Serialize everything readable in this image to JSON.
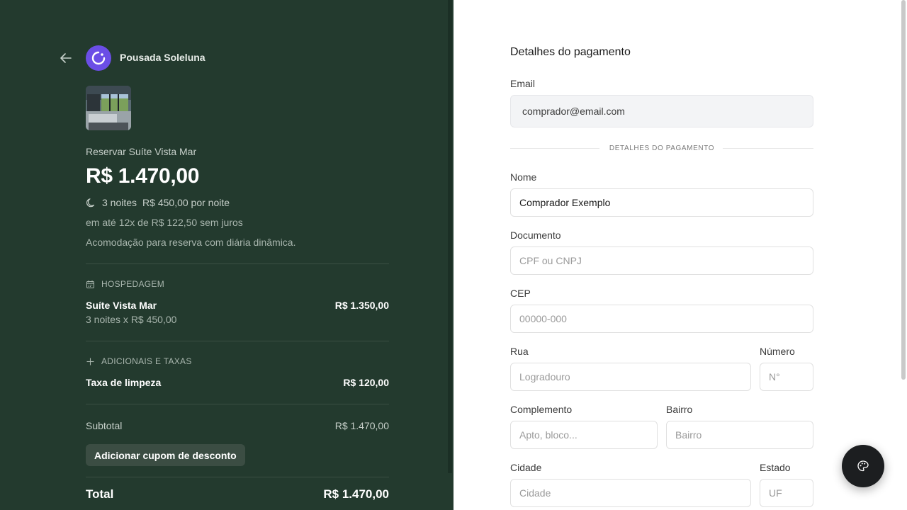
{
  "merchant": {
    "name": "Pousada Soleluna"
  },
  "product": {
    "title": "Reservar Suíte Vista Mar",
    "price": "R$ 1.470,00",
    "nights": "3 noites",
    "per_night": "R$ 450,00 por noite",
    "installments": "em até 12x de R$ 122,50 sem juros",
    "description": "Acomodação para reserva com diária dinâmica."
  },
  "summary": {
    "lodging_section": "HOSPEDAGEM",
    "lodging_item": {
      "name": "Suíte Vista Mar",
      "detail": "3 noites x R$ 450,00",
      "amount": "R$ 1.350,00"
    },
    "extras_section": "ADICIONAIS E TAXAS",
    "extras_item": {
      "name": "Taxa de limpeza",
      "amount": "R$ 120,00"
    },
    "subtotal_label": "Subtotal",
    "subtotal_amount": "R$ 1.470,00",
    "coupon_label": "Adicionar cupom de desconto",
    "total_label": "Total",
    "total_amount": "R$ 1.470,00"
  },
  "form": {
    "title": "Detalhes do pagamento",
    "email": {
      "label": "Email",
      "value": "comprador@email.com"
    },
    "separator": "DETALHES DO PAGAMENTO",
    "name": {
      "label": "Nome",
      "value": "Comprador Exemplo"
    },
    "document": {
      "label": "Documento",
      "placeholder": "CPF ou CNPJ"
    },
    "cep": {
      "label": "CEP",
      "placeholder": "00000-000"
    },
    "street": {
      "label": "Rua",
      "placeholder": "Logradouro"
    },
    "number": {
      "label": "Número",
      "placeholder": "N°"
    },
    "complement": {
      "label": "Complemento",
      "placeholder": "Apto, bloco..."
    },
    "district": {
      "label": "Bairro",
      "placeholder": "Bairro"
    },
    "city": {
      "label": "Cidade",
      "placeholder": "Cidade"
    },
    "state": {
      "label": "Estado",
      "placeholder": "UF"
    }
  },
  "colors": {
    "left_panel": "#233a2e",
    "logo": "#6b4ee6",
    "fab": "#1c1e20"
  },
  "icons": {
    "back": "arrow-left-icon",
    "logo": "circle-arc-logo-icon",
    "nights": "moon-icon",
    "lodging": "calendar-icon",
    "extras": "plus-icon",
    "fab": "palette-icon"
  }
}
